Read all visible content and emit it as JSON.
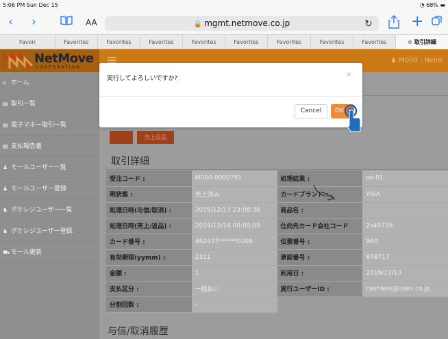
{
  "status_bar": {
    "time": "5:06 PM  Sun Dec 15",
    "battery": "68%"
  },
  "browser": {
    "text_size_label": "AA",
    "url": "mgmt.netmove.co.jp",
    "favorites": [
      {
        "label": "Favori"
      },
      {
        "label": "Favorites"
      },
      {
        "label": "Favorites"
      },
      {
        "label": "Favorites"
      },
      {
        "label": "Favorites"
      },
      {
        "label": "Favorites"
      },
      {
        "label": "Favorites"
      },
      {
        "label": "Favorites"
      },
      {
        "label": "Favorites"
      },
      {
        "label": "取引詳細"
      }
    ]
  },
  "header": {
    "logo_text": "NetMove",
    "logo_sub": "CORPORATION",
    "user": "M000 : Neiro"
  },
  "sidebar": {
    "items": [
      {
        "icon": "home-icon",
        "label": "ホーム"
      },
      {
        "icon": "document-icon",
        "label": "取引一覧"
      },
      {
        "icon": "document-icon",
        "label": "電子マネー取引一覧"
      },
      {
        "icon": "document-icon",
        "label": "支払報告書"
      },
      {
        "icon": "user-icon",
        "label": "モールユーザー一覧"
      },
      {
        "icon": "user-icon",
        "label": "モールユーザー登録"
      },
      {
        "icon": "users-icon",
        "label": "ポケレジユーザー一覧"
      },
      {
        "icon": "users-icon",
        "label": "ポケレジユーザー登録"
      },
      {
        "icon": "cart-icon",
        "label": "モール更新"
      }
    ]
  },
  "main": {
    "buttons": {
      "secondary": "売上返品"
    },
    "section_title": "取引詳細",
    "detail_rows": [
      {
        "k1": "受注コード :",
        "v1": "M000-0000791",
        "k2": "処理結果 :",
        "v2": "ok-01"
      },
      {
        "k1": "現状態 :",
        "v1": "売上済み",
        "k2": "カードブランド :",
        "v2": "VISA"
      },
      {
        "k1": "処理日時(与信/取消) :",
        "v1": "2019/12/13 23:08:36",
        "k2": "商品名 :",
        "v2": ""
      },
      {
        "k1": "処理日時(売上/返品) :",
        "v1": "2019/12/14 00:00:00",
        "k2": "仕向先カード会社コード",
        "v2": "2s49739"
      },
      {
        "k1": "カード番号 :",
        "v1": "462437******0109",
        "k2": "伝票番号 :",
        "v2": "960"
      },
      {
        "k1": "有効期限(yymm) :",
        "v1": "2311",
        "k2": "承認番号 :",
        "v2": "878717"
      },
      {
        "k1": "金額 :",
        "v1": "1",
        "k2": "利用日 :",
        "v2": "2019/12/13"
      },
      {
        "k1": "支払区分 :",
        "v1": "一括払い",
        "k2": "実行ユーザーID :",
        "v2": "cashless@usen.co.jp"
      },
      {
        "k1": "分割回数 :",
        "v1": "-",
        "k2": "",
        "v2": ""
      }
    ],
    "history_title": "与信/取消履歴"
  },
  "dialog": {
    "message": "実行してよろしいですか?",
    "close": "×",
    "cancel_label": "Cancel",
    "ok_label": "OK"
  },
  "colors": {
    "header_orange": "#cb7a16",
    "ok_button": "#ef8a3a",
    "safari_blue": "#2a7df6"
  }
}
